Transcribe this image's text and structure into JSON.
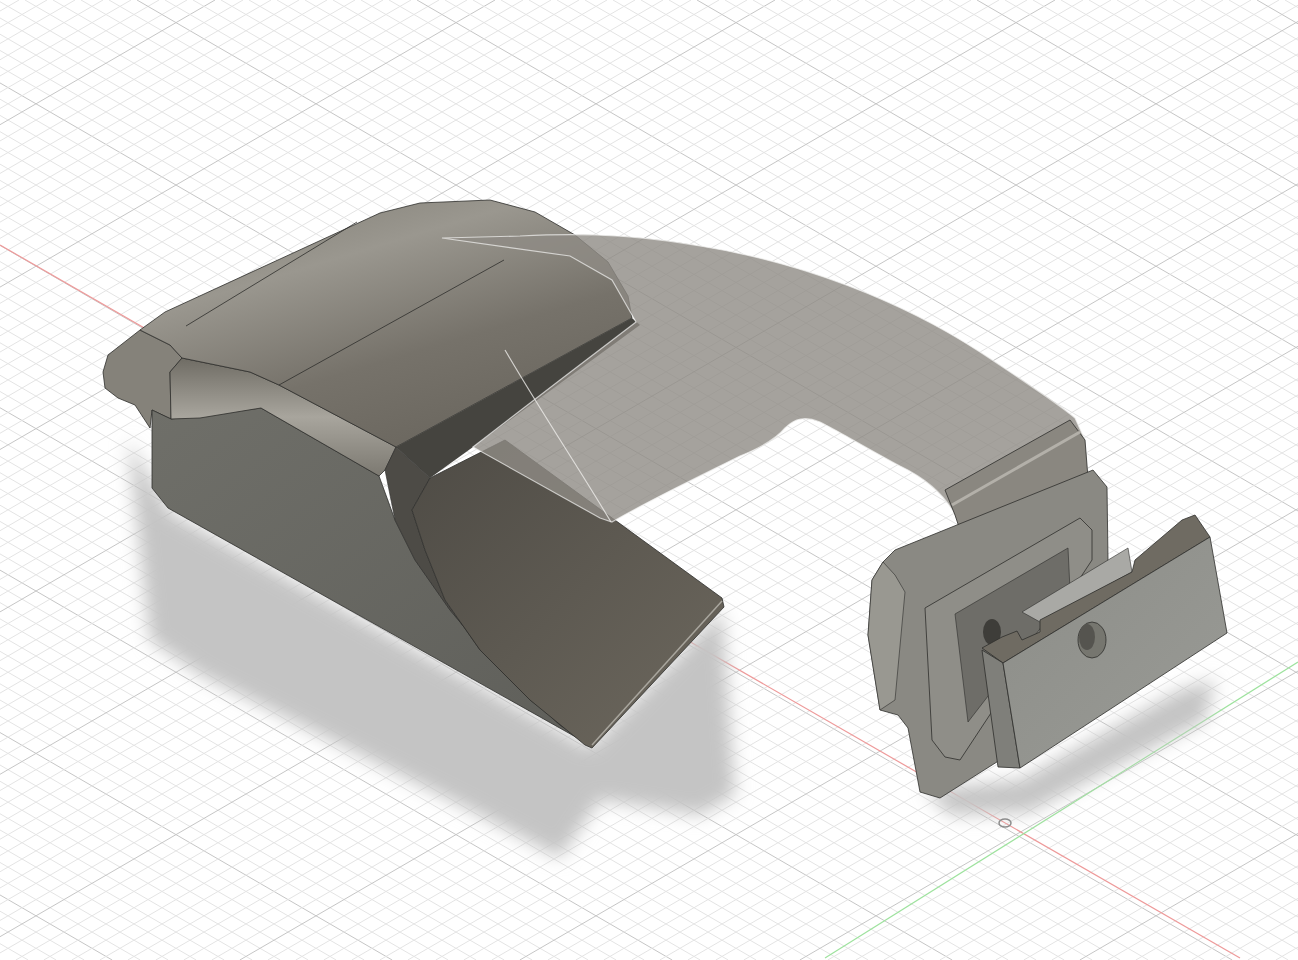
{
  "viewport": {
    "grid_visible": true,
    "axes_visible": true,
    "shadows_visible": true
  }
}
